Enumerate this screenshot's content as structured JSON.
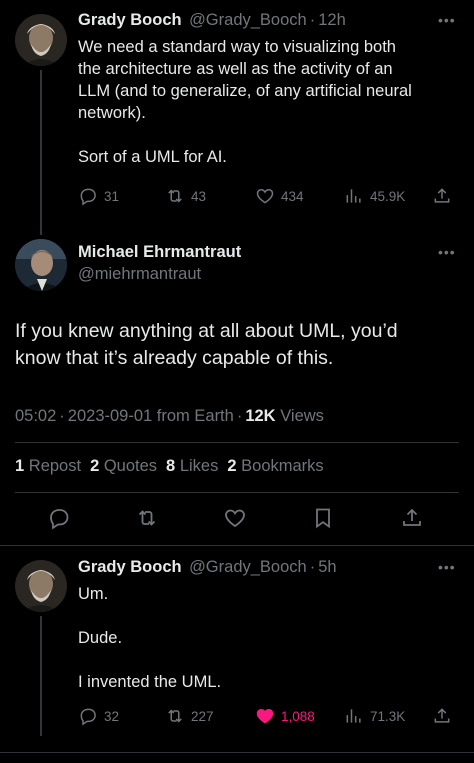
{
  "tweet1": {
    "name": "Grady Booch",
    "handle": "@Grady_Booch",
    "time": "12h",
    "lines": [
      "We need a standard way to visualizing both",
      "the architecture as well as the activity of an",
      "LLM (and to generalize, of any artificial neural",
      "network).",
      "",
      "Sort of a UML for AI."
    ],
    "replies": "31",
    "reposts": "43",
    "likes": "434",
    "views": "45.9K"
  },
  "main": {
    "name": "Michael Ehrmantraut",
    "handle": "@miehrmantraut",
    "lines": [
      "If you knew anything at all about UML, you’d",
      "know that it’s already capable of this."
    ],
    "time": "05:02",
    "date": "2023-09-01",
    "source": "from Earth",
    "views_count": "12K",
    "views_label": "Views",
    "reposts_count": "1",
    "reposts_label": "Repost",
    "quotes_count": "2",
    "quotes_label": "Quotes",
    "likes_count": "8",
    "likes_label": "Likes",
    "bookmarks_count": "2",
    "bookmarks_label": "Bookmarks"
  },
  "tweet3": {
    "name": "Grady Booch",
    "handle": "@Grady_Booch",
    "time": "5h",
    "lines": [
      "Um.",
      "",
      "Dude.",
      "",
      "I invented the UML."
    ],
    "replies": "32",
    "reposts": "227",
    "likes": "1,088",
    "views": "71.3K"
  },
  "icons": {
    "more": "more-icon",
    "reply": "reply-icon",
    "repost": "repost-icon",
    "like": "heart-icon",
    "views": "views-icon",
    "share": "share-icon",
    "bookmark": "bookmark-icon"
  },
  "colors": {
    "background": "#000000",
    "text": "#e7e9ea",
    "muted": "#71767b",
    "like_active": "#f91880"
  },
  "sep": "·"
}
